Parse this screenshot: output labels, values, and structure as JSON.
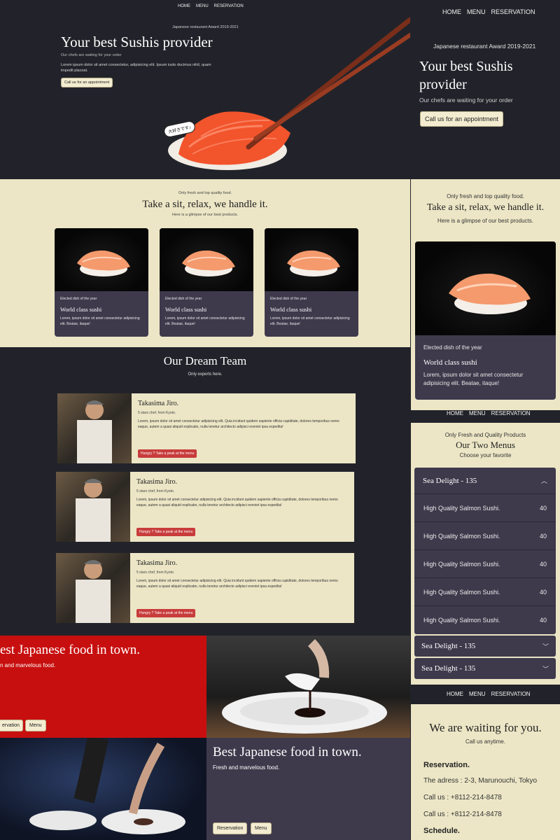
{
  "nav": {
    "home": "HOME",
    "menu": "MENU",
    "reservation": "RESERVATION"
  },
  "hero": {
    "award": "Japanese restaurant Award 2019-2021",
    "title": "Your best Sushis provider",
    "subtitle": "Our chefs are waiting for your order",
    "lorem": "Lorem ipsum dolor sit amet consectetur, adipisicing elit. Ipsum iusto ducimus nihil, quam impedit placeat.",
    "cta": "Call us for an appointment",
    "bubble": "大好きです♪"
  },
  "hero_mobile": {
    "award": "Japanese restaurant Award 2019-2021",
    "title": "Your best Sushis provider",
    "subtitle": "Our chefs are waiting for your order",
    "cta": "Call us for an appointment"
  },
  "products": {
    "kicker": "Only fresh and top quality food.",
    "title": "Take a sit, relax, we handle it.",
    "subtitle": "Here is a glimpse of our best products.",
    "cards": [
      {
        "tag": "Elected dish of the year",
        "name": "World class sushi",
        "text": "Lorem, ipsum dolor sit amet consectetur adipisicing elit. Beatae, itaque!"
      },
      {
        "tag": "Elected dish of the year",
        "name": "World class sushi",
        "text": "Lorem, ipsum dolor sit amet consectetur adipisicing elit. Beatae, itaque!"
      },
      {
        "tag": "Elected dish of the year",
        "name": "World class sushi",
        "text": "Lorem, ipsum dolor sit amet consectetur adipisicing elit. Beatae, itaque!"
      }
    ]
  },
  "products_mobile": {
    "kicker": "Only fresh and top quality food.",
    "title": "Take a sit, relax, we handle it.",
    "subtitle": "Here is a glimpse of our best products.",
    "card": {
      "tag": "Elected dish of the year",
      "name": "World class sushi",
      "text": "Lorem, ipsum dolor sit amet consectetur adipisicing elit. Beatae, itaque!"
    }
  },
  "team": {
    "title": "Our Dream Team",
    "subtitle": "Only experts here.",
    "members": [
      {
        "name": "Takasima Jiro.",
        "meta": "5 stars chef, from Kyoto.",
        "bio": "Lorem, ipsum dolor sit amet consectetur adipisicing elit. Quia incidunt quidem sapiente officia cupiditate, dolores temporibus nemo eaque, autem a quasi aliquid explicabo, nulla tenetur architecto adipisci eveniet ipsa expedita!",
        "cta": "Hungry ? Take a peak at the menu"
      },
      {
        "name": "Takasima Jiro.",
        "meta": "5 stars chef, from Kyoto.",
        "bio": "Lorem, ipsum dolor sit amet consectetur adipisicing elit. Quia incidunt quidem sapiente officia cupiditate, dolores temporibus nemo eaque, autem a quasi aliquid explicabo, nulla tenetur architecto adipisci eveniet ipsa expedita!",
        "cta": "Hungry ? Take a peak at the menu"
      },
      {
        "name": "Takasima Jiro.",
        "meta": "5 stars chef, from Kyoto.",
        "bio": "Lorem, ipsum dolor sit amet consectetur adipisicing elit. Quia incidunt quidem sapiente officia cupiditate, dolores temporibus nemo eaque, autem a quasi aliquid explicabo, nulla tenetur architecto adipisci eveniet ipsa expedita!",
        "cta": "Hungry ? Take a peak at the menu"
      }
    ]
  },
  "menus_mobile": {
    "nav": {
      "home": "HOME",
      "menu": "MENU",
      "reservation": "RESERVATION"
    },
    "kicker": "Only Fresh and Quality Products",
    "title": "Our Two Menus",
    "subtitle": "Choose your favorite",
    "open": {
      "header": "Sea Delight - 135",
      "items": [
        {
          "name": "High Quality Salmon Sushi.",
          "price": "40"
        },
        {
          "name": "High Quality Salmon Sushi.",
          "price": "40"
        },
        {
          "name": "High Quality Salmon Sushi.",
          "price": "40"
        },
        {
          "name": "High Quality Salmon Sushi.",
          "price": "40"
        },
        {
          "name": "High Quality Salmon Sushi.",
          "price": "40"
        }
      ]
    },
    "closed": [
      "Sea Delight - 135",
      "Sea Delight - 135"
    ]
  },
  "promo": {
    "red_title": "est Japanese food in town.",
    "red_sub": "n and marvelous food.",
    "red_btn_reservation": "ervation",
    "red_btn_menu": "Menu",
    "title": "Best Japanese food in town.",
    "sub": "Fresh and marvelous food.",
    "btn_reservation": "Reservation",
    "btn_menu": "Menu"
  },
  "contact_mobile": {
    "nav": {
      "home": "HOME",
      "menu": "MENU",
      "reservation": "RESERVATION"
    },
    "title": "We are waiting for you.",
    "subtitle": "Call us anytime.",
    "reservation_heading": "Reservation.",
    "address": "The adress : 2-3, Marunouchi, Tokyo",
    "phone1": "Call us : +8112-214-8478",
    "phone2": "Call us : +8112-214-8478",
    "schedule_heading": "Schedule."
  },
  "colors": {
    "dark": "#22232a",
    "cream": "#ece6c6",
    "card": "#3e3a4c",
    "red": "#c80f0f",
    "button_red": "#c83c3c"
  }
}
